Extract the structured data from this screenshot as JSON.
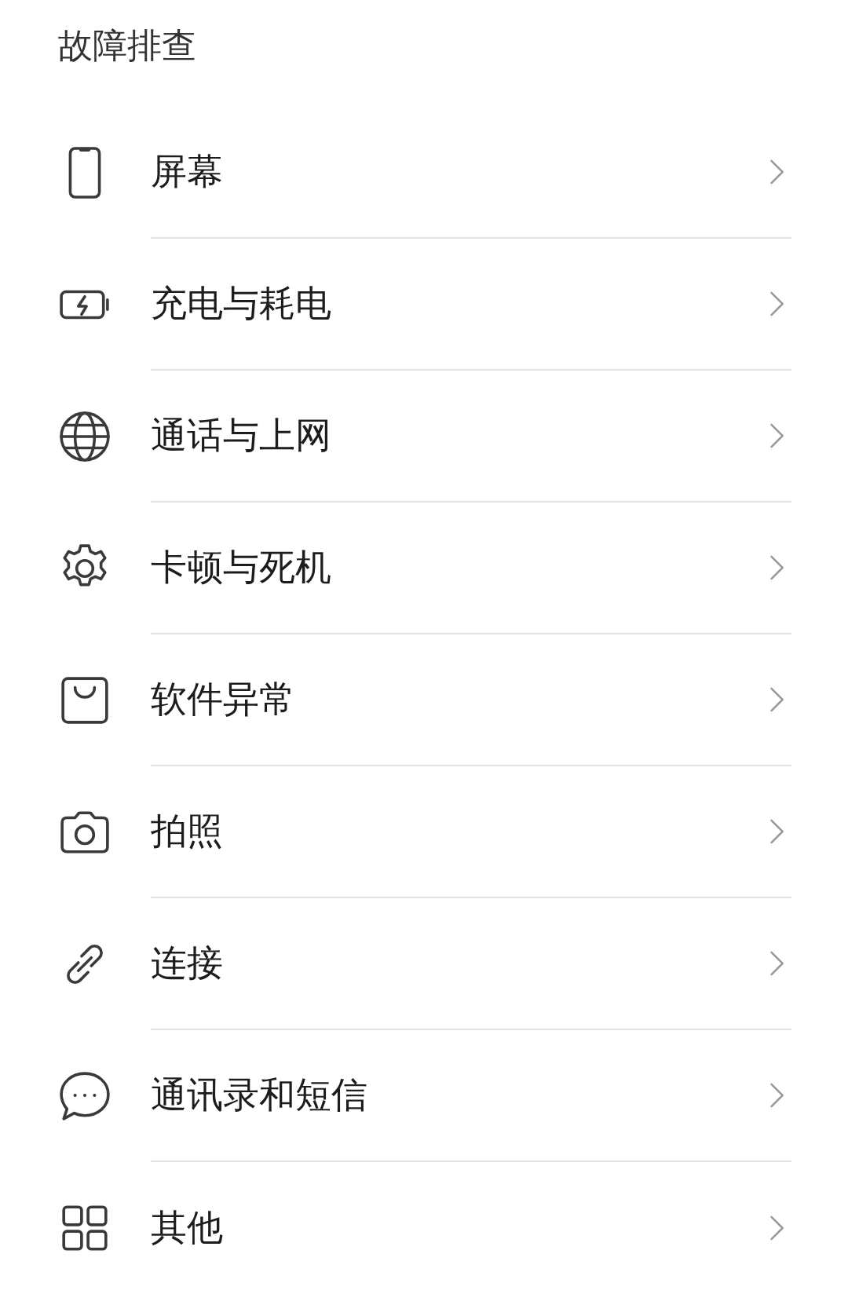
{
  "title": "故障排查",
  "items": [
    {
      "label": "屏幕",
      "kind": "phone"
    },
    {
      "label": "充电与耗电",
      "kind": "battery"
    },
    {
      "label": "通话与上网",
      "kind": "globe"
    },
    {
      "label": "卡顿与死机",
      "kind": "gear"
    },
    {
      "label": "软件异常",
      "kind": "bag"
    },
    {
      "label": "拍照",
      "kind": "camera"
    },
    {
      "label": "连接",
      "kind": "link"
    },
    {
      "label": "通讯录和短信",
      "kind": "chat"
    },
    {
      "label": "其他",
      "kind": "grid"
    }
  ]
}
